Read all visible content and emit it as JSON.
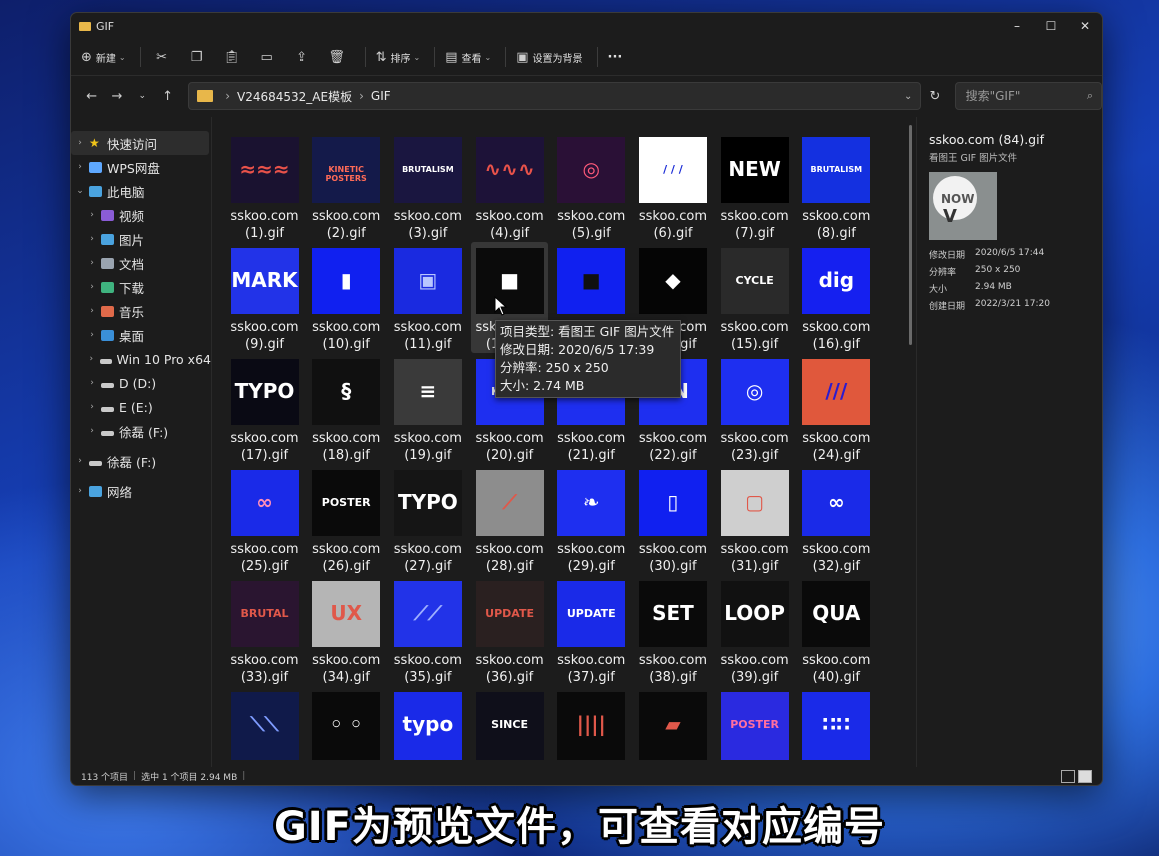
{
  "window": {
    "title": "GIF",
    "controls": [
      "–",
      "☐",
      "✕"
    ]
  },
  "toolbar": {
    "new_label": "新建",
    "sort_label": "排序",
    "view_label": "查看",
    "set_bg_label": "设置为背景",
    "more_label": "···"
  },
  "address": {
    "crumbs": [
      "V24684532_AE模板",
      "GIF"
    ],
    "search_placeholder": "搜索\"GIF\""
  },
  "sidebar": {
    "items": [
      {
        "label": "快速访问",
        "icon": "star-icon",
        "color": "#f0c419",
        "level": 0
      },
      {
        "label": "WPS网盘",
        "icon": "cloud-icon",
        "color": "#5ea8ff",
        "level": 0
      },
      {
        "label": "此电脑",
        "icon": "computer-icon",
        "color": "#4aa3df",
        "level": 0
      },
      {
        "label": "视频",
        "icon": "video-icon",
        "color": "#8a5cd6",
        "level": 1
      },
      {
        "label": "图片",
        "icon": "picture-icon",
        "color": "#4aa3df",
        "level": 1
      },
      {
        "label": "文档",
        "icon": "document-icon",
        "color": "#9aa4b0",
        "level": 1
      },
      {
        "label": "下载",
        "icon": "download-icon",
        "color": "#3fb37f",
        "level": 1
      },
      {
        "label": "音乐",
        "icon": "music-icon",
        "color": "#e06a4a",
        "level": 1
      },
      {
        "label": "桌面",
        "icon": "desktop-icon",
        "color": "#3a8fd8",
        "level": 1
      },
      {
        "label": "Win 10 Pro x64",
        "icon": "drive-icon",
        "color": "#c9c9c9",
        "level": 1
      },
      {
        "label": "D (D:)",
        "icon": "drive-icon",
        "color": "#c9c9c9",
        "level": 1
      },
      {
        "label": "E (E:)",
        "icon": "drive-icon",
        "color": "#c9c9c9",
        "level": 1
      },
      {
        "label": "徐磊 (F:)",
        "icon": "drive-icon",
        "color": "#c9c9c9",
        "level": 1
      },
      {
        "label": "徐磊 (F:)",
        "icon": "drive-icon",
        "color": "#c9c9c9",
        "level": 0
      },
      {
        "label": "网络",
        "icon": "network-icon",
        "color": "#4aa3df",
        "level": 0
      }
    ]
  },
  "files": [
    {
      "line1": "sskoo.com",
      "line2": "(1).gif",
      "bg": "#1a1230",
      "fg": "#e8524a",
      "text": "≈≈≈"
    },
    {
      "line1": "sskoo.com",
      "line2": "(2).gif",
      "bg": "#141a4a",
      "fg": "#ff6b57",
      "text": "KINETIC POSTERS"
    },
    {
      "line1": "sskoo.com",
      "line2": "(3).gif",
      "bg": "#1a1640",
      "fg": "#ffffff",
      "text": "BRUTALISM"
    },
    {
      "line1": "sskoo.com",
      "line2": "(4).gif",
      "bg": "#1d1238",
      "fg": "#e8524a",
      "text": "∿∿∿"
    },
    {
      "line1": "sskoo.com",
      "line2": "(5).gif",
      "bg": "#2a1036",
      "fg": "#ff5a7a",
      "text": "◎"
    },
    {
      "line1": "sskoo.com",
      "line2": "(6).gif",
      "bg": "#ffffff",
      "fg": "#1a2bd6",
      "text": "/ / /"
    },
    {
      "line1": "sskoo.com",
      "line2": "(7).gif",
      "bg": "#000000",
      "fg": "#ffffff",
      "text": "NEW"
    },
    {
      "line1": "sskoo.com",
      "line2": "(8).gif",
      "bg": "#1430e0",
      "fg": "#ffffff",
      "text": "BRUTALISM"
    },
    {
      "line1": "sskoo.com",
      "line2": "(9).gif",
      "bg": "#2233e8",
      "fg": "#ffffff",
      "text": "MARK"
    },
    {
      "line1": "sskoo.com",
      "line2": "(10).gif",
      "bg": "#1020f0",
      "fg": "#ffffff",
      "text": "▮"
    },
    {
      "line1": "sskoo.com",
      "line2": "(11).gif",
      "bg": "#1a2ae0",
      "fg": "#b8c6ff",
      "text": "▣"
    },
    {
      "line1": "sskoo.com",
      "line2": "(12).gif",
      "bg": "#0b0b0b",
      "fg": "#ffffff",
      "text": "■"
    },
    {
      "line1": "sskoo.com",
      "line2": "(13).gif",
      "bg": "#1020f0",
      "fg": "#101010",
      "text": "■"
    },
    {
      "line1": "sskoo.com",
      "line2": "(14).gif",
      "bg": "#050505",
      "fg": "#ffffff",
      "text": "◆"
    },
    {
      "line1": "sskoo.com",
      "line2": "(15).gif",
      "bg": "#2a2a2a",
      "fg": "#ffffff",
      "text": "CYCLE"
    },
    {
      "line1": "sskoo.com",
      "line2": "(16).gif",
      "bg": "#1520f0",
      "fg": "#ffffff",
      "text": "dig"
    },
    {
      "line1": "sskoo.com",
      "line2": "(17).gif",
      "bg": "#0a0a14",
      "fg": "#ffffff",
      "text": "TYPO"
    },
    {
      "line1": "sskoo.com",
      "line2": "(18).gif",
      "bg": "#101010",
      "fg": "#ffffff",
      "text": "§"
    },
    {
      "line1": "sskoo.com",
      "line2": "(19).gif",
      "bg": "#3a3a3a",
      "fg": "#ffffff",
      "text": "≡"
    },
    {
      "line1": "sskoo.com",
      "line2": "(20).gif",
      "bg": "#1e2ff0",
      "fg": "#ffffff",
      "text": "KINET"
    },
    {
      "line1": "sskoo.com",
      "line2": "(21).gif",
      "bg": "#1e2ff0",
      "fg": "#ffffff",
      "text": "▱"
    },
    {
      "line1": "sskoo.com",
      "line2": "(22).gif",
      "bg": "#1e2ff0",
      "fg": "#ffffff",
      "text": "BN"
    },
    {
      "line1": "sskoo.com",
      "line2": "(23).gif",
      "bg": "#1e2ff0",
      "fg": "#ffffff",
      "text": "◎"
    },
    {
      "line1": "sskoo.com",
      "line2": "(24).gif",
      "bg": "#e0583c",
      "fg": "#2a1bd0",
      "text": "///"
    },
    {
      "line1": "sskoo.com",
      "line2": "(25).gif",
      "bg": "#1a2ae8",
      "fg": "#ff8fb8",
      "text": "∞"
    },
    {
      "line1": "sskoo.com",
      "line2": "(26).gif",
      "bg": "#0a0a0a",
      "fg": "#ffffff",
      "text": "POSTER"
    },
    {
      "line1": "sskoo.com",
      "line2": "(27).gif",
      "bg": "#151515",
      "fg": "#ffffff",
      "text": "TYPO"
    },
    {
      "line1": "sskoo.com",
      "line2": "(28).gif",
      "bg": "#8d8d8d",
      "fg": "#e0584a",
      "text": "⟋"
    },
    {
      "line1": "sskoo.com",
      "line2": "(29).gif",
      "bg": "#1e2ff0",
      "fg": "#ffffff",
      "text": "❧"
    },
    {
      "line1": "sskoo.com",
      "line2": "(30).gif",
      "bg": "#1020f0",
      "fg": "#ffffff",
      "text": "▯"
    },
    {
      "line1": "sskoo.com",
      "line2": "(31).gif",
      "bg": "#cfcfcf",
      "fg": "#e0584a",
      "text": "▢"
    },
    {
      "line1": "sskoo.com",
      "line2": "(32).gif",
      "bg": "#1a2ae8",
      "fg": "#ffffff",
      "text": "∞"
    },
    {
      "line1": "sskoo.com",
      "line2": "(33).gif",
      "bg": "#2a1530",
      "fg": "#e0584a",
      "text": "BRUTAL"
    },
    {
      "line1": "sskoo.com",
      "line2": "(34).gif",
      "bg": "#b5b5b5",
      "fg": "#e0584a",
      "text": "UX"
    },
    {
      "line1": "sskoo.com",
      "line2": "(35).gif",
      "bg": "#2233e8",
      "fg": "#9fb0ff",
      "text": "⟋⟋"
    },
    {
      "line1": "sskoo.com",
      "line2": "(36).gif",
      "bg": "#2a2020",
      "fg": "#e0584a",
      "text": "UPDATE"
    },
    {
      "line1": "sskoo.com",
      "line2": "(37).gif",
      "bg": "#1a2ae8",
      "fg": "#ffffff",
      "text": "UPDATE"
    },
    {
      "line1": "sskoo.com",
      "line2": "(38).gif",
      "bg": "#0a0a0a",
      "fg": "#ffffff",
      "text": "SET"
    },
    {
      "line1": "sskoo.com",
      "line2": "(39).gif",
      "bg": "#111111",
      "fg": "#ffffff",
      "text": "LOOP"
    },
    {
      "line1": "sskoo.com",
      "line2": "(40).gif",
      "bg": "#0a0a0a",
      "fg": "#ffffff",
      "text": "QUA"
    },
    {
      "line1": "sskoo.com",
      "line2": "",
      "bg": "#101a4a",
      "fg": "#7f9cff",
      "text": "⟍⟍"
    },
    {
      "line1": "sskoo.com",
      "line2": "",
      "bg": "#0a0a0a",
      "fg": "#ffffff",
      "text": "◦ ◦"
    },
    {
      "line1": "sskoo.com",
      "line2": "",
      "bg": "#1a2ae8",
      "fg": "#ffffff",
      "text": "typo"
    },
    {
      "line1": "sskoo.com",
      "line2": "",
      "bg": "#0f0f1a",
      "fg": "#ffffff",
      "text": "SINCE"
    },
    {
      "line1": "sskoo.com",
      "line2": "",
      "bg": "#0a0a0a",
      "fg": "#e0584a",
      "text": "||||"
    },
    {
      "line1": "sskoo.com",
      "line2": "",
      "bg": "#0a0a0a",
      "fg": "#e0584a",
      "text": "▰"
    },
    {
      "line1": "sskoo.com",
      "line2": "",
      "bg": "#2a2ae0",
      "fg": "#ff6fa0",
      "text": "POSTER"
    },
    {
      "line1": "sskoo.com",
      "line2": "",
      "bg": "#1a2ae8",
      "fg": "#ffffff",
      "text": "∷∷"
    }
  ],
  "selected_index": 11,
  "tooltip": {
    "lines": [
      "项目类型: 看图王 GIF 图片文件",
      "修改日期: 2020/6/5 17:39",
      "分辨率: 250 x 250",
      "大小: 2.74 MB"
    ]
  },
  "details": {
    "name": "sskoo.com (84).gif",
    "type": "看图王 GIF 图片文件",
    "preview_text": "NOW",
    "rows": [
      {
        "k": "修改日期",
        "v": "2020/6/5 17:44"
      },
      {
        "k": "分辨率",
        "v": "250 x 250"
      },
      {
        "k": "大小",
        "v": "2.94 MB"
      },
      {
        "k": "创建日期",
        "v": "2022/3/21 17:20"
      }
    ]
  },
  "status": {
    "count": "113 个项目",
    "selected": "选中 1 个项目  2.94 MB"
  },
  "subtitle": "GIF为预览文件，可查看对应编号"
}
